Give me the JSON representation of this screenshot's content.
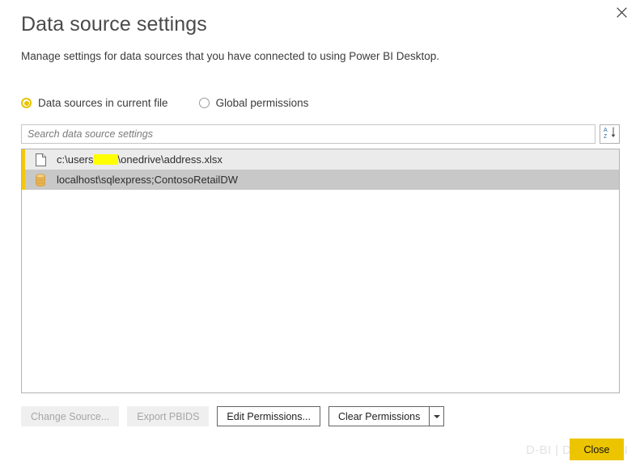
{
  "window": {
    "close_icon": "close-icon"
  },
  "header": {
    "title": "Data source settings",
    "subtitle": "Manage settings for data sources that you have connected to using Power BI Desktop."
  },
  "scope": {
    "options": [
      {
        "label": "Data sources in current file",
        "selected": true
      },
      {
        "label": "Global permissions",
        "selected": false
      }
    ]
  },
  "search": {
    "value": "",
    "placeholder": "Search data source settings",
    "sort_icon": "sort-az-descending-icon",
    "sort_top_letter": "A",
    "sort_bottom_letter": "Z"
  },
  "list": {
    "rows": [
      {
        "icon": "file-document-icon",
        "label_before": "c:\\users",
        "label_after": "\\onedrive\\address.xlsx",
        "redacted": true,
        "state": "hover"
      },
      {
        "icon": "database-cylinder-icon",
        "label_before": "localhost\\sqlexpress;ContosoRetailDW",
        "label_after": "",
        "redacted": false,
        "state": "selected"
      }
    ]
  },
  "toolbar": {
    "change_source_label": "Change Source...",
    "export_pbids_label": "Export PBIDS",
    "edit_permissions_label": "Edit Permissions...",
    "clear_permissions_label": "Clear Permissions",
    "clear_permissions_caret_icon": "chevron-down-icon"
  },
  "footer": {
    "watermark": "D-BI | Davis on BI",
    "close_label": "Close",
    "close_color": "#ecc500"
  }
}
